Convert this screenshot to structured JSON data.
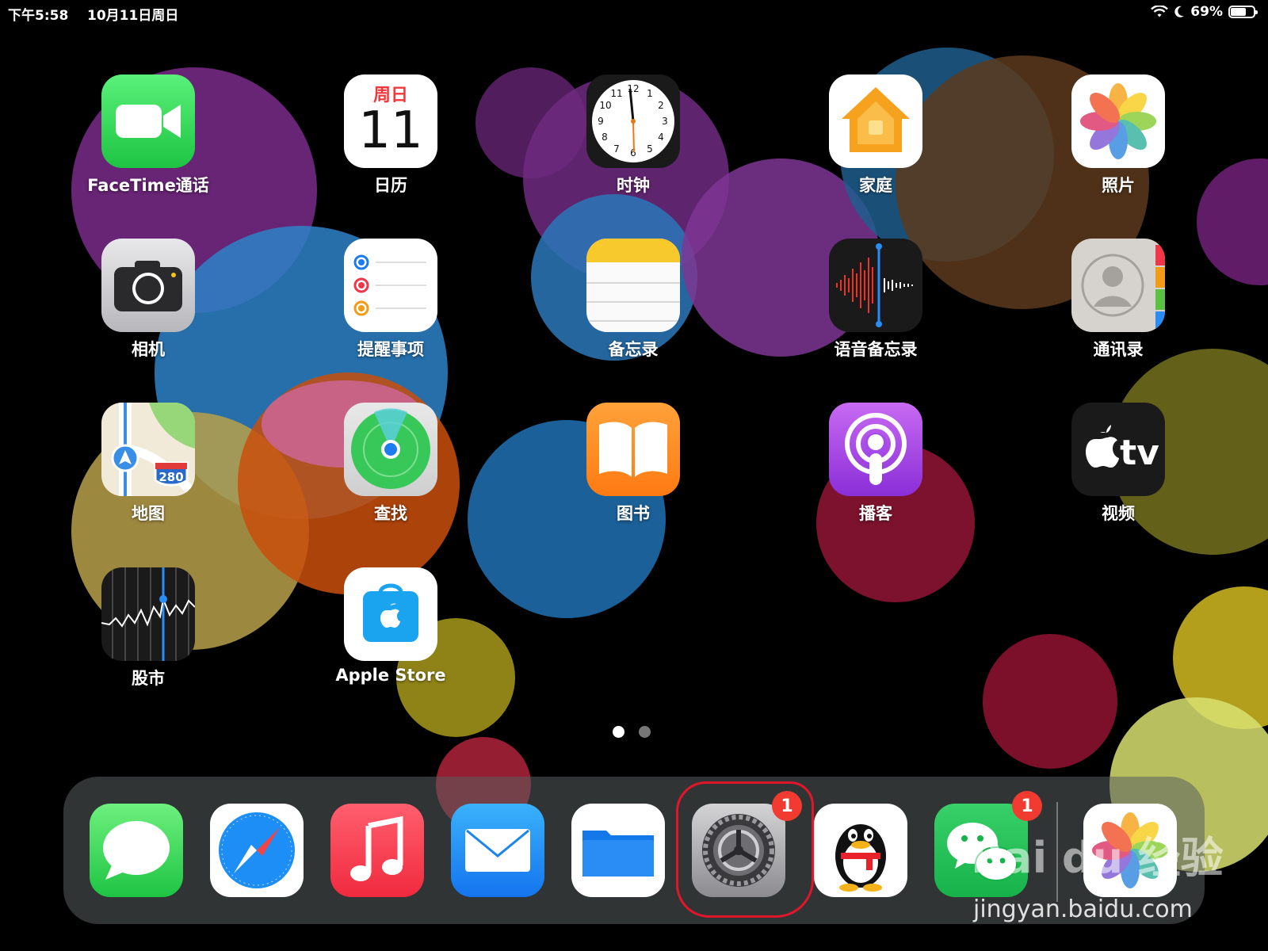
{
  "status_bar": {
    "time": "下午5:58",
    "date": "10月11日周日",
    "battery_percent": "69%",
    "battery_level": 0.69
  },
  "apps": [
    {
      "label": "FaceTime通话",
      "icon": "facetime-icon"
    },
    {
      "label": "日历",
      "icon": "calendar-icon",
      "calendar_weekday": "周日",
      "calendar_day": "11"
    },
    {
      "label": "时钟",
      "icon": "clock-icon",
      "clock_numbers": [
        "12",
        "1",
        "2",
        "3",
        "4",
        "5",
        "6",
        "7",
        "8",
        "9",
        "10",
        "11"
      ]
    },
    {
      "label": "家庭",
      "icon": "home-icon"
    },
    {
      "label": "照片",
      "icon": "photos-icon"
    },
    {
      "label": "相机",
      "icon": "camera-icon"
    },
    {
      "label": "提醒事项",
      "icon": "reminders-icon"
    },
    {
      "label": "备忘录",
      "icon": "notes-icon"
    },
    {
      "label": "语音备忘录",
      "icon": "voice-memos-icon"
    },
    {
      "label": "通讯录",
      "icon": "contacts-icon"
    },
    {
      "label": "地图",
      "icon": "maps-icon",
      "map_shield": "280"
    },
    {
      "label": "查找",
      "icon": "find-my-icon"
    },
    {
      "label": "图书",
      "icon": "books-icon"
    },
    {
      "label": "播客",
      "icon": "podcasts-icon"
    },
    {
      "label": "视频",
      "icon": "apple-tv-icon",
      "tv_text": "tv"
    },
    {
      "label": "股市",
      "icon": "stocks-icon"
    },
    {
      "label": "Apple Store",
      "icon": "apple-store-icon"
    }
  ],
  "page_indicator": {
    "pages": 2,
    "current": 1
  },
  "dock": {
    "apps": [
      {
        "icon": "messages-icon"
      },
      {
        "icon": "safari-icon"
      },
      {
        "icon": "music-icon"
      },
      {
        "icon": "mail-icon"
      },
      {
        "icon": "files-icon"
      },
      {
        "icon": "settings-icon",
        "badge": "1"
      },
      {
        "icon": "qq-icon"
      },
      {
        "icon": "wechat-icon",
        "badge": "1"
      },
      {
        "icon": "photos-icon"
      }
    ]
  },
  "watermark": {
    "brand": "Bai du 经验",
    "url": "jingyan.baidu.com"
  },
  "colors": {
    "badge": "#f23b30",
    "annotation": "#e0162b",
    "facetime": "#2fd158",
    "books": "#ff8a1e",
    "podcasts": "#a54bea"
  }
}
